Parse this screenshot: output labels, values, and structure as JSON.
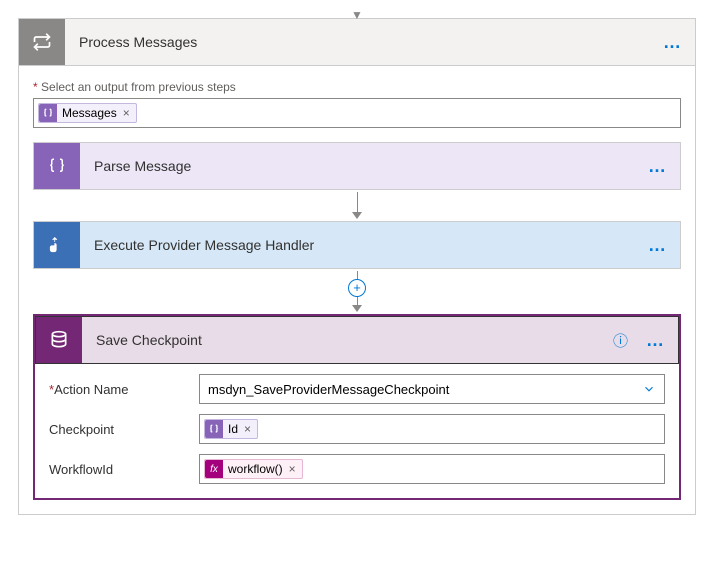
{
  "top_step": {
    "title": "Process Messages"
  },
  "output_label": "Select an output from previous steps",
  "tokens": {
    "messages": "Messages",
    "close": "×"
  },
  "parse_step": {
    "title": "Parse Message"
  },
  "exec_step": {
    "title": "Execute Provider Message Handler"
  },
  "save_step": {
    "title": "Save Checkpoint",
    "fields": {
      "action_name": {
        "label": "Action Name",
        "value": "msdyn_SaveProviderMessageCheckpoint"
      },
      "checkpoint": {
        "label": "Checkpoint",
        "token": "Id"
      },
      "workflow": {
        "label": "WorkflowId",
        "token": "workflow()",
        "fx_label": "fx"
      }
    }
  },
  "ui": {
    "ellipsis": "…",
    "help": "?",
    "plus": "+",
    "dropdown_caret": "▼",
    "chevron": "⌄"
  }
}
